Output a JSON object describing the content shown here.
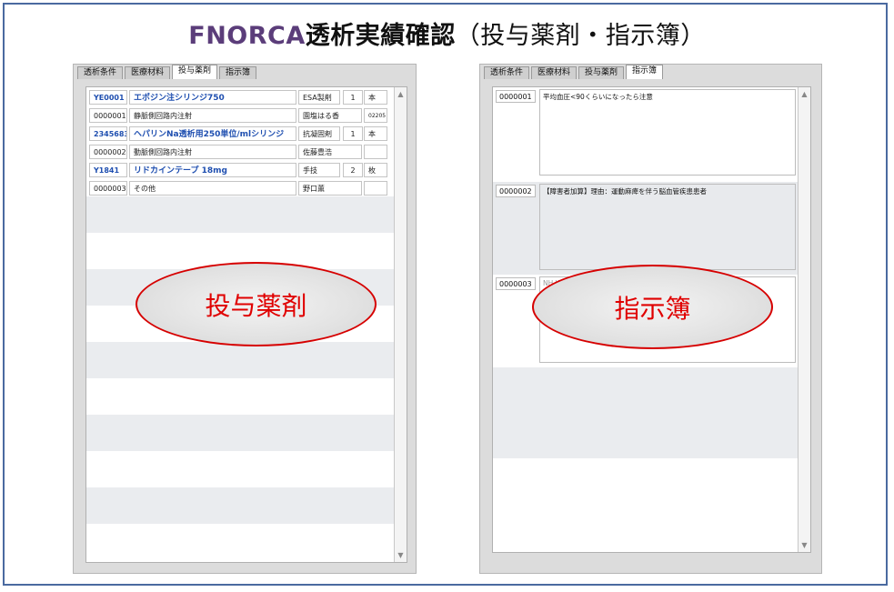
{
  "title": {
    "brand": "FNORCA",
    "main": "透析実績確認",
    "paren": "（投与薬剤・指示簿）"
  },
  "tabs": [
    "透析条件",
    "医療材料",
    "投与薬剤",
    "指示簿"
  ],
  "left_panel": {
    "active_tab": "投与薬剤",
    "rows": [
      {
        "code": "YE0001",
        "name": "エポジン注シリンジ750",
        "cat": "ESA製剤",
        "qty": "1",
        "unit": "本",
        "style": "blue"
      },
      {
        "code": "0000001",
        "name": "静脈側回路内注射",
        "cat": "園塩はる香",
        "qty": "",
        "unit": "02205",
        "style": "plain"
      },
      {
        "code": "2345683",
        "name": "ヘパリンNa透析用250単位/mlシリンジ",
        "cat": "抗凝固剤",
        "qty": "1",
        "unit": "本",
        "style": "blue"
      },
      {
        "code": "0000002",
        "name": "動脈側回路内注射",
        "cat": "佐藤豊浩",
        "qty": "",
        "unit": "",
        "style": "plain"
      },
      {
        "code": "Y1841",
        "name": "リドカインテープ 18mg",
        "cat": "手技",
        "qty": "2",
        "unit": "枚",
        "style": "blue"
      },
      {
        "code": "0000003",
        "name": "その他",
        "cat": "野口薫",
        "qty": "",
        "unit": "",
        "style": "plain"
      }
    ],
    "overlay_label": "投与薬剤",
    "scroll_up": "▲",
    "scroll_down": "▼"
  },
  "right_panel": {
    "active_tab": "指示簿",
    "notes": [
      {
        "code": "0000001",
        "text": "平均血圧<90くらいになったら注意"
      },
      {
        "code": "0000002",
        "text": "【障害者加算】理由：運動麻痺を伴う脳血管疾患患者"
      },
      {
        "code": "0000003",
        "text": "NH-Weight 60.3kg (2017/12/07)"
      }
    ],
    "overlay_label": "指示簿",
    "scroll_up": "▲",
    "scroll_down": "▼"
  },
  "colors": {
    "brand": "#5b3d7a",
    "frame": "#4a6aa0",
    "highlight_text": "#1f4fb0",
    "overlay_red": "#d60000"
  }
}
